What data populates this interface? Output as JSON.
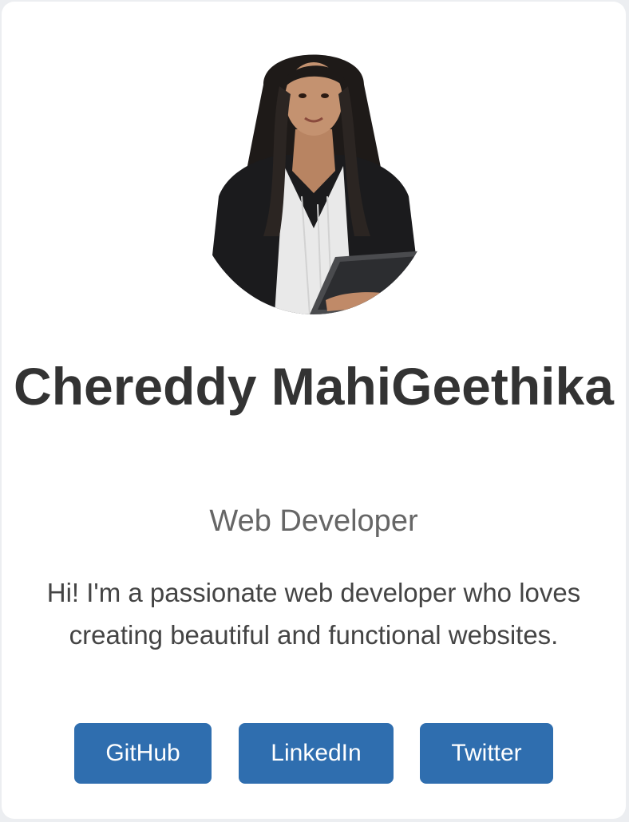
{
  "profile": {
    "name": "Chereddy MahiGeethika",
    "title": "Web Developer",
    "bio": "Hi! I'm a passionate web developer who loves creating beautiful and functional websites."
  },
  "links": {
    "github": "GitHub",
    "linkedin": "LinkedIn",
    "twitter": "Twitter"
  },
  "colors": {
    "button": "#2f6eaf",
    "name": "#333333",
    "role": "#666666",
    "background": "#eceef1",
    "card": "#ffffff"
  },
  "icons": {
    "avatar": "profile-photo"
  }
}
